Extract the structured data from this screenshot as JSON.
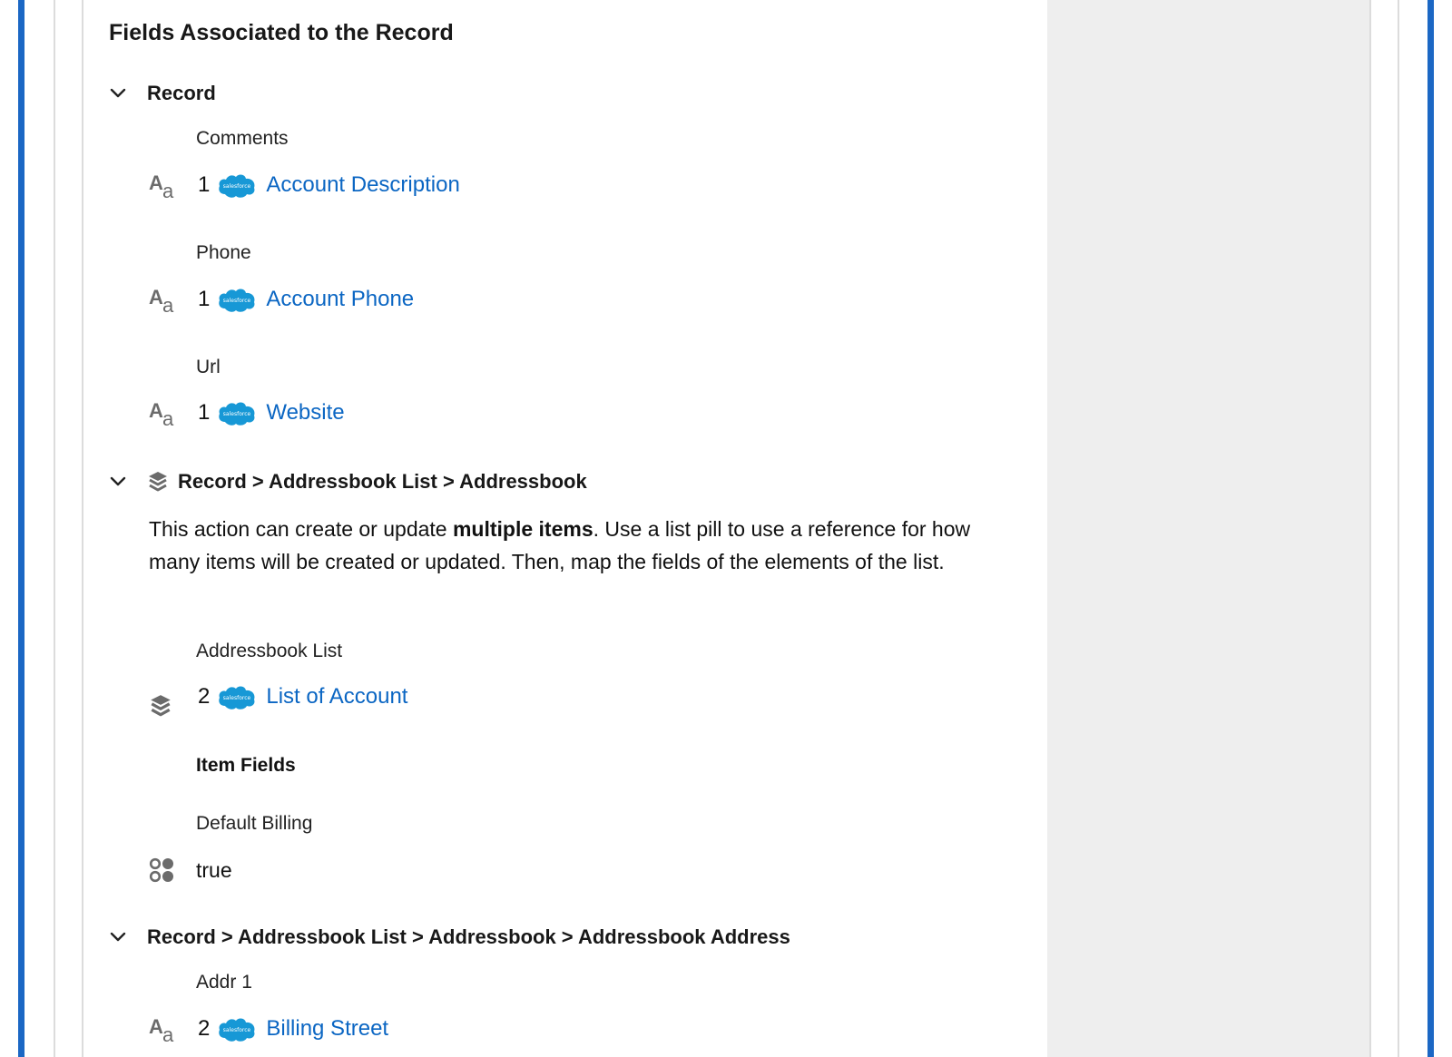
{
  "title": "Fields Associated to the Record",
  "colors": {
    "accent_blue": "#1b67c4",
    "link": "#0b66c3",
    "salesforce_cloud": "#1798d6",
    "icon_gray": "#6b6b6b"
  },
  "sections": [
    {
      "header": "Record",
      "header_icon": null,
      "fields": [
        {
          "label": "Comments",
          "type_icon": "text-type-icon",
          "index": "1",
          "source_icon": "salesforce-icon",
          "value": "Account Description"
        },
        {
          "label": "Phone",
          "type_icon": "text-type-icon",
          "index": "1",
          "source_icon": "salesforce-icon",
          "value": "Account Phone"
        },
        {
          "label": "Url",
          "type_icon": "text-type-icon",
          "index": "1",
          "source_icon": "salesforce-icon",
          "value": "Website"
        }
      ]
    },
    {
      "header": "Record > Addressbook List > Addressbook",
      "header_icon": "layers-icon",
      "description": {
        "before": "This action can create or update ",
        "bold": "multiple items",
        "after": ". Use a list pill to use a reference for how many items will be created or updated. Then, map the fields of the elements of the list."
      },
      "list_field": {
        "label": "Addressbook List",
        "type_icon": "layers-icon",
        "index": "2",
        "source_icon": "salesforce-icon",
        "value": "List of Account"
      },
      "item_fields_heading": "Item Fields",
      "item_fields": [
        {
          "label": "Default Billing",
          "type_icon": "boolean-icon",
          "value": "true"
        }
      ]
    },
    {
      "header": "Record > Addressbook List > Addressbook > Addressbook Address",
      "header_icon": null,
      "fields": [
        {
          "label": "Addr 1",
          "type_icon": "text-type-icon",
          "index": "2",
          "source_icon": "salesforce-icon",
          "value": "Billing Street"
        }
      ]
    }
  ],
  "icons": {
    "aa_big": "A",
    "aa_small": "a",
    "salesforce_text": "salesforce"
  }
}
